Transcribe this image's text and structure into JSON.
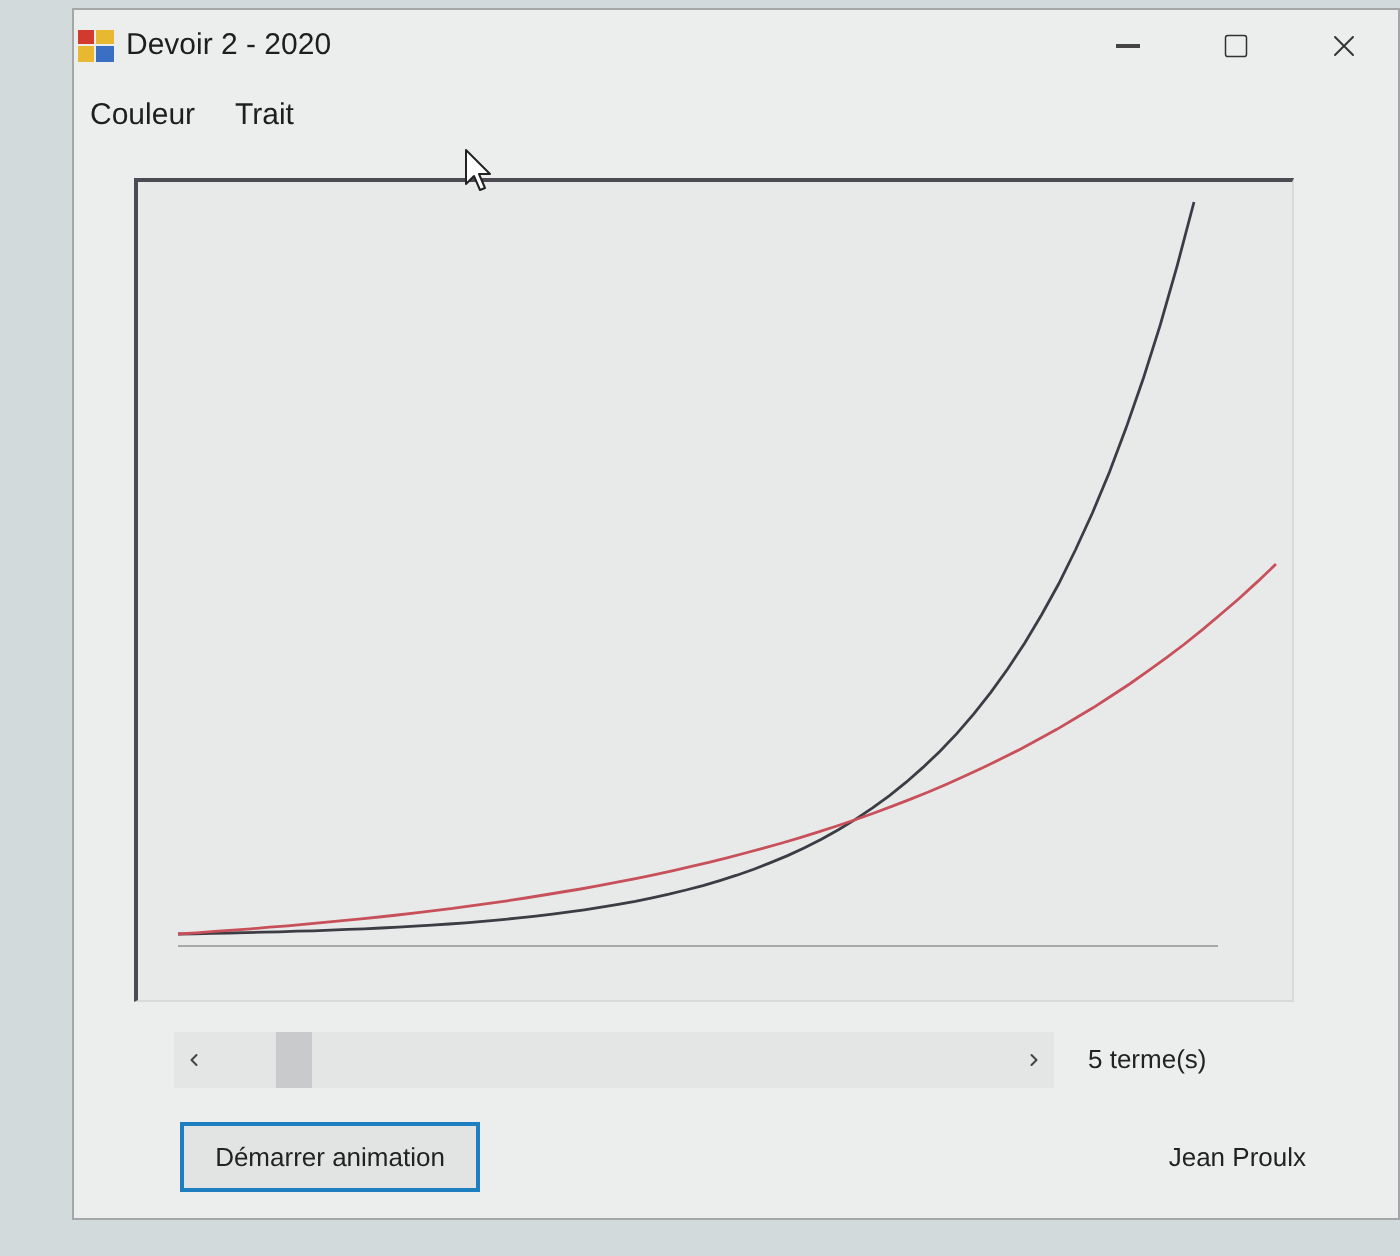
{
  "window": {
    "title": "Devoir 2 - 2020"
  },
  "menu": [
    {
      "label": "Couleur"
    },
    {
      "label": "Trait"
    }
  ],
  "chart": {
    "curves": [
      {
        "kind": "steep",
        "color": "#3c3c44"
      },
      {
        "kind": "gentle",
        "color": "#c8505a"
      }
    ]
  },
  "terms_label": "5 terme(s)",
  "start_button": {
    "label": "Démarrer animation",
    "focused": true
  },
  "author": "Jean Proulx"
}
